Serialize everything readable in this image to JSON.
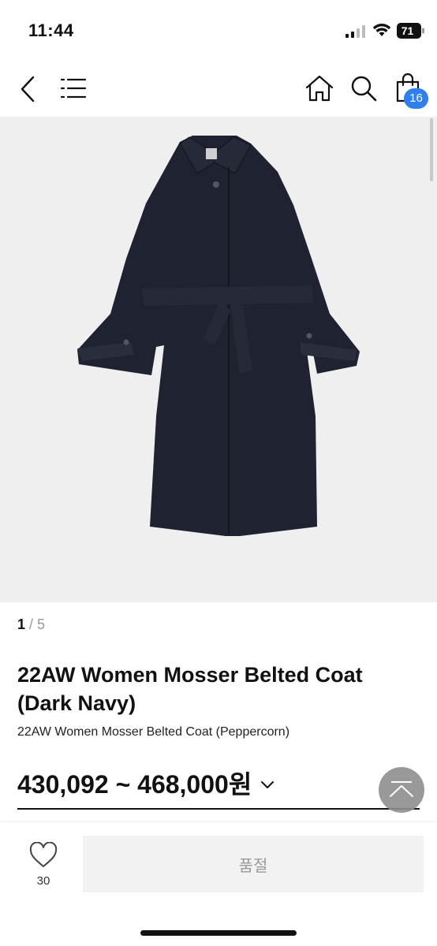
{
  "status_bar": {
    "time": "11:44",
    "battery": "71"
  },
  "nav": {
    "cart_count": "16"
  },
  "gallery": {
    "current": "1",
    "separator": " / ",
    "total": "5"
  },
  "product": {
    "title": "22AW Women Mosser Belted Coat (Dark Navy)",
    "subtitle": "22AW Women Mosser Belted Coat (Peppercorn)",
    "price": "430,092 ~ 468,000원"
  },
  "bottom_bar": {
    "like_count": "30",
    "action_label": "품절"
  },
  "colors": {
    "badge": "#2f80ed",
    "coat": "#1f2230",
    "image_bg": "#efefef"
  }
}
